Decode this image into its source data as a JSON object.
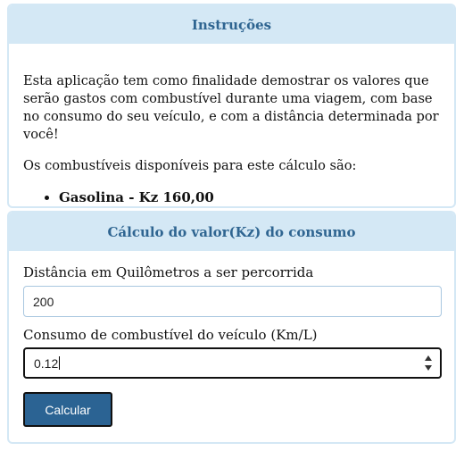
{
  "instructions": {
    "title": "Instruções",
    "intro": "Esta aplicação tem como finalidade demostrar os valores que serão gastos com combustível durante uma viagem, com base no consumo do seu veículo, e com a distância determinada por você!",
    "fuels_intro": "Os combustíveis disponíveis para este cálculo são:",
    "fuels": [
      "Gasolina - Kz 160,00"
    ]
  },
  "calculator": {
    "title": "Cálculo do valor(Kz) do consumo",
    "distance_label": "Distância em Quilômetros a ser percorrida",
    "distance_value": "200",
    "consumption_label": "Consumo de combustível do veículo (Km/L)",
    "consumption_value": "0.12",
    "calculate_button": "Calcular"
  },
  "colors": {
    "header_bg": "#d4e8f5",
    "header_text": "#2f6591",
    "button_bg": "#2b6393"
  }
}
